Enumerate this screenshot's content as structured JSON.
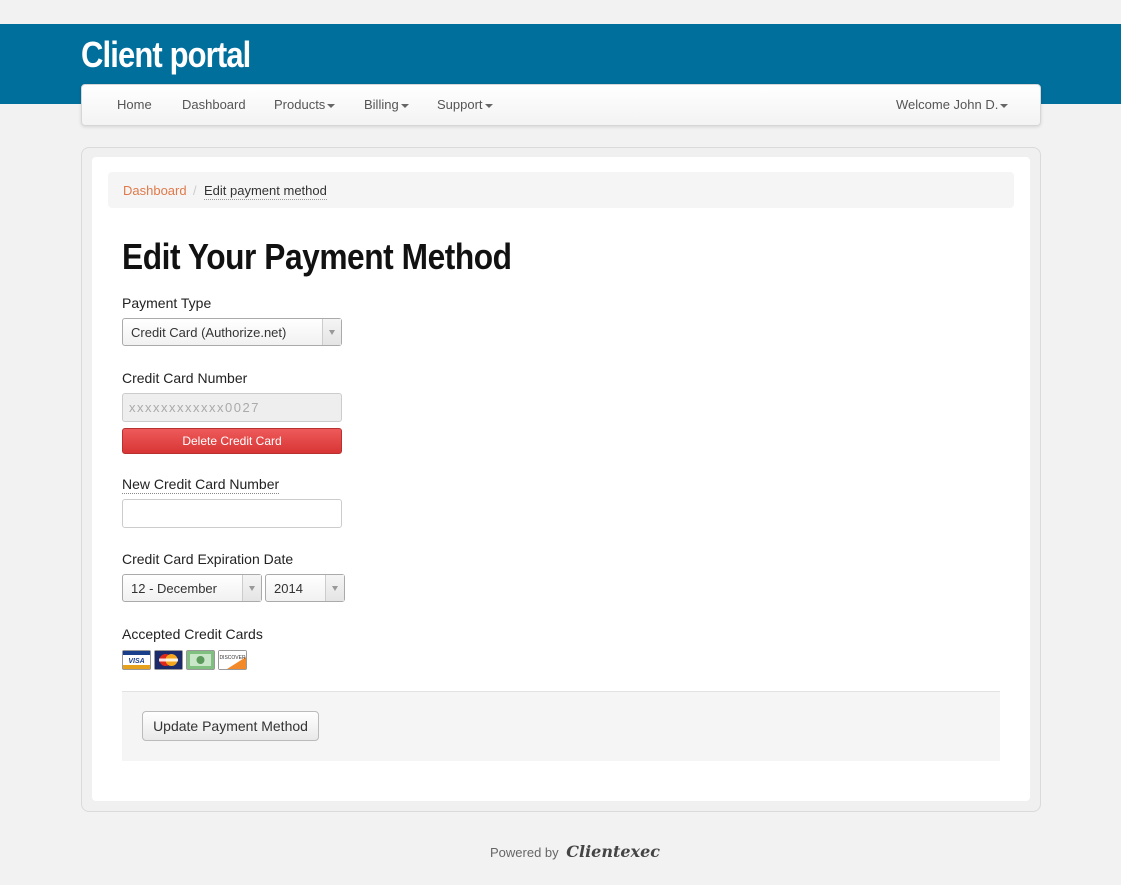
{
  "header": {
    "brand": "Client portal"
  },
  "nav": {
    "home": "Home",
    "dashboard": "Dashboard",
    "products": "Products",
    "billing": "Billing",
    "support": "Support",
    "user": "Welcome John D."
  },
  "breadcrumb": {
    "link": "Dashboard",
    "separator": "/",
    "current": "Edit payment method"
  },
  "page": {
    "title": "Edit Your Payment Method"
  },
  "form": {
    "payment_type_label": "Payment Type",
    "payment_type_value": "Credit Card (Authorize.net)",
    "card_number_label": "Credit Card Number",
    "card_number_value": "xxxxxxxxxxxx0027",
    "delete_button": "Delete Credit Card",
    "new_card_label": "New Credit Card Number",
    "new_card_value": "",
    "expiration_label": "Credit Card Expiration Date",
    "exp_month": "12 - December",
    "exp_year": "2014",
    "accepted_label": "Accepted Credit Cards",
    "cards": [
      "visa-icon",
      "mastercard-icon",
      "amex-icon",
      "discover-icon"
    ],
    "submit_button": "Update Payment Method"
  },
  "footer": {
    "powered_by": "Powered by",
    "logo_text": "Clientexec"
  },
  "colors": {
    "header": "#006f9c",
    "danger": "#d83535",
    "breadcrumb_link": "#e07a4a"
  }
}
